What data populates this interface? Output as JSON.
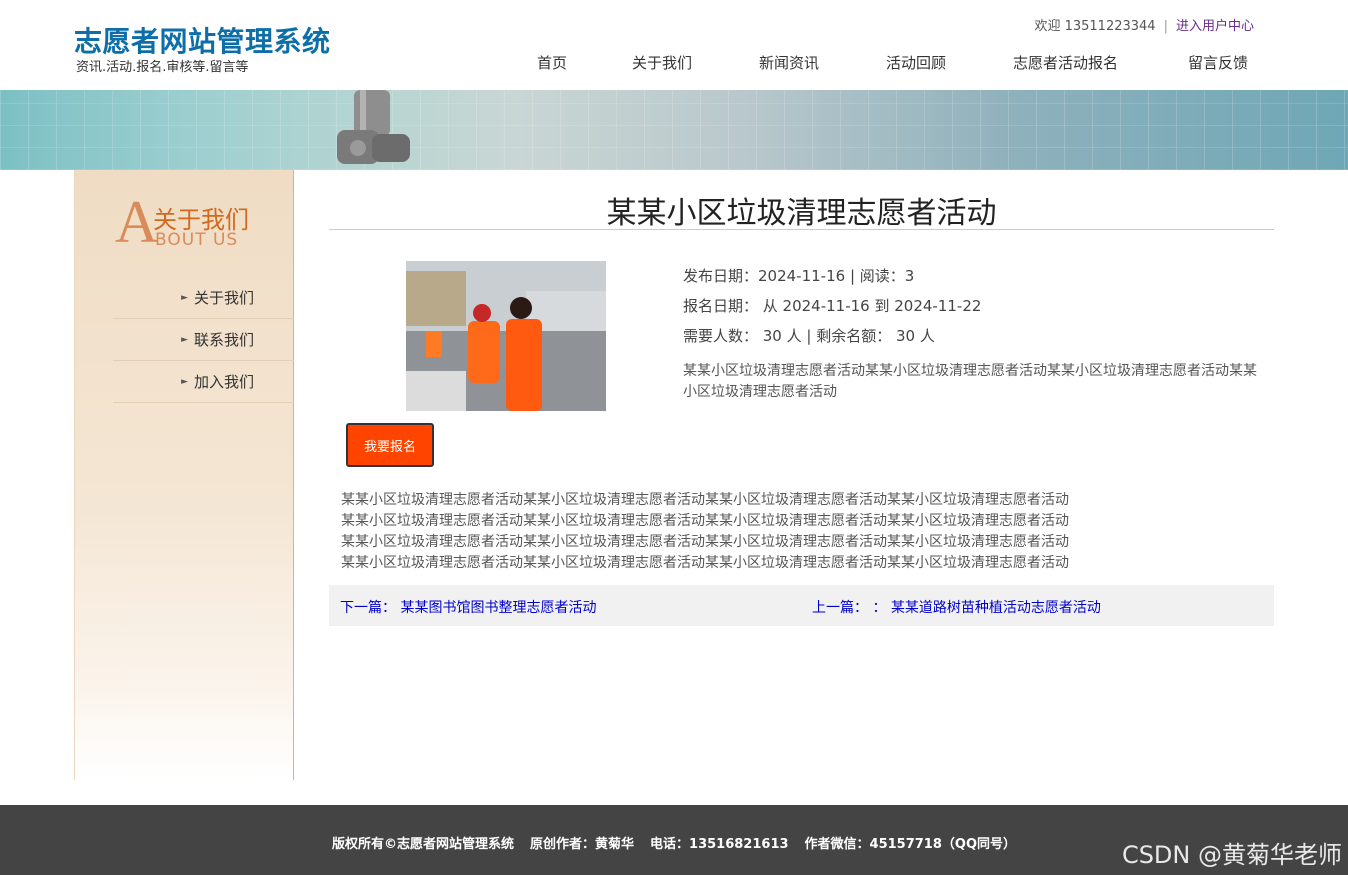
{
  "header": {
    "site_title": "志愿者网站管理系统",
    "site_subtitle": "资讯.活动.报名.审核等.留言等",
    "welcome_text": "欢迎 13511223344",
    "separator": "|",
    "user_center_link": "进入用户中心"
  },
  "nav": {
    "items": [
      "首页",
      "关于我们",
      "新闻资讯",
      "活动回顾",
      "志愿者活动报名",
      "留言反馈"
    ]
  },
  "sidebar": {
    "big_letter": "A",
    "title_cn": "关于我们",
    "title_en": "BOUT US",
    "arrow_glyph": "►",
    "items": [
      "关于我们",
      "联系我们",
      "加入我们"
    ]
  },
  "article": {
    "title": "某某小区垃圾清理志愿者活动",
    "publish_line": "发布日期：2024-11-16  |  阅读：3",
    "signup_period_line": "报名日期： 从 2024-11-16 到 2024-11-22",
    "quota_line": "需要人数： 30 人       | 剩余名额： 30 人",
    "summary": "某某小区垃圾清理志愿者活动某某小区垃圾清理志愿者活动某某小区垃圾清理志愿者活动某某小区垃圾清理志愿者活动",
    "signup_button": "我要报名",
    "body_lines": [
      "某某小区垃圾清理志愿者活动某某小区垃圾清理志愿者活动某某小区垃圾清理志愿者活动某某小区垃圾清理志愿者活动",
      "某某小区垃圾清理志愿者活动某某小区垃圾清理志愿者活动某某小区垃圾清理志愿者活动某某小区垃圾清理志愿者活动",
      "某某小区垃圾清理志愿者活动某某小区垃圾清理志愿者活动某某小区垃圾清理志愿者活动某某小区垃圾清理志愿者活动",
      "某某小区垃圾清理志愿者活动某某小区垃圾清理志愿者活动某某小区垃圾清理志愿者活动某某小区垃圾清理志愿者活动"
    ],
    "next_link": "下一篇： 某某图书馆图书整理志愿者活动",
    "prev_link": "上一篇： ： 某某道路树苗种植活动志愿者活动"
  },
  "footer": {
    "copyright": "版权所有©志愿者网站管理系统",
    "author": "原创作者：黄菊华",
    "phone": "电话：13516821613",
    "wechat": "作者微信：45157718（QQ同号）"
  },
  "watermark": "CSDN @黄菊华老师",
  "colors": {
    "brand_blue": "#0e6ea8",
    "signup_orange": "#ff4400",
    "about_orange": "#d2691e",
    "footer_bg": "#444444",
    "link_blue": "#0000cc"
  }
}
